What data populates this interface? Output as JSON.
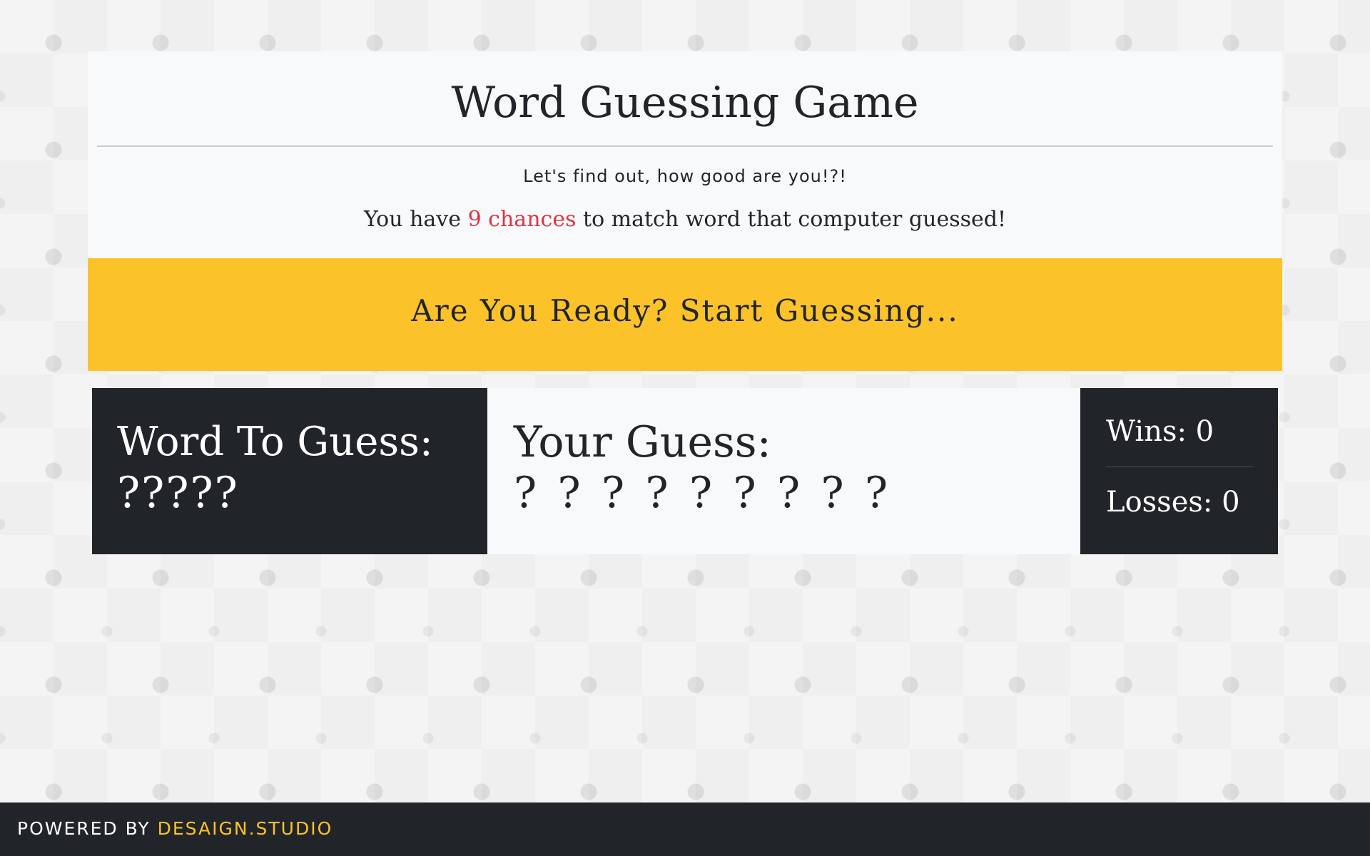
{
  "header": {
    "title": "Word Guessing Game",
    "subtitle": "Let's find out, how good are you!?!",
    "chances_prefix": "You have",
    "chances_highlight": "9 chances",
    "chances_suffix": "to match word that computer guessed!"
  },
  "banner": {
    "text": "Are You Ready? Start Guessing..."
  },
  "word_panel": {
    "label": "Word To Guess:",
    "value": "?????"
  },
  "guess_panel": {
    "label": "Your Guess:",
    "slots": [
      "?",
      "?",
      "?",
      "?",
      "?",
      "?",
      "?",
      "?",
      "?"
    ]
  },
  "stats": {
    "wins": "Wins: 0",
    "losses": "Losses: 0"
  },
  "footer": {
    "powered_by": "POWERED BY",
    "brand": "DESAIGN.STUDIO"
  },
  "colors": {
    "accent_yellow": "#fcc22a",
    "dark": "#212529",
    "highlight_red": "#dc3545",
    "light_panel": "#f8f9fa"
  }
}
